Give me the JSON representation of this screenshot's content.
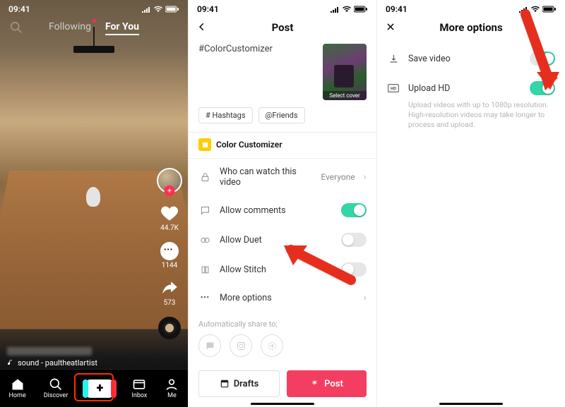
{
  "phone1": {
    "time": "09:41",
    "tabs": {
      "following": "Following",
      "foryou": "For You"
    },
    "rail": {
      "likes": "44.7K",
      "comments": "1144",
      "shares": "573"
    },
    "music": "sound - paultheatlartist",
    "nav": {
      "home": "Home",
      "discover": "Discover",
      "inbox": "Inbox",
      "me": "Me"
    }
  },
  "phone2": {
    "time": "09:41",
    "title": "Post",
    "caption": "#ColorCustomizer",
    "cover_label": "Select cover",
    "pills": {
      "hashtags": "# Hashtags",
      "friends": "@Friends"
    },
    "tag_label": "Color Customizer",
    "rows": {
      "privacy_label": "Who can watch this video",
      "privacy_value": "Everyone",
      "comments": "Allow comments",
      "duet": "Allow Duet",
      "stitch": "Allow Stitch",
      "more": "More options"
    },
    "share_label": "Automatically share to;",
    "buttons": {
      "drafts": "Drafts",
      "post": "Post"
    }
  },
  "phone3": {
    "time": "09:41",
    "title": "More options",
    "rows": {
      "save": "Save video",
      "upload_hd": "Upload HD",
      "upload_desc": "Upload videos with up to 1080p resolution. High-resolution videos may take longer to process and upload."
    }
  }
}
